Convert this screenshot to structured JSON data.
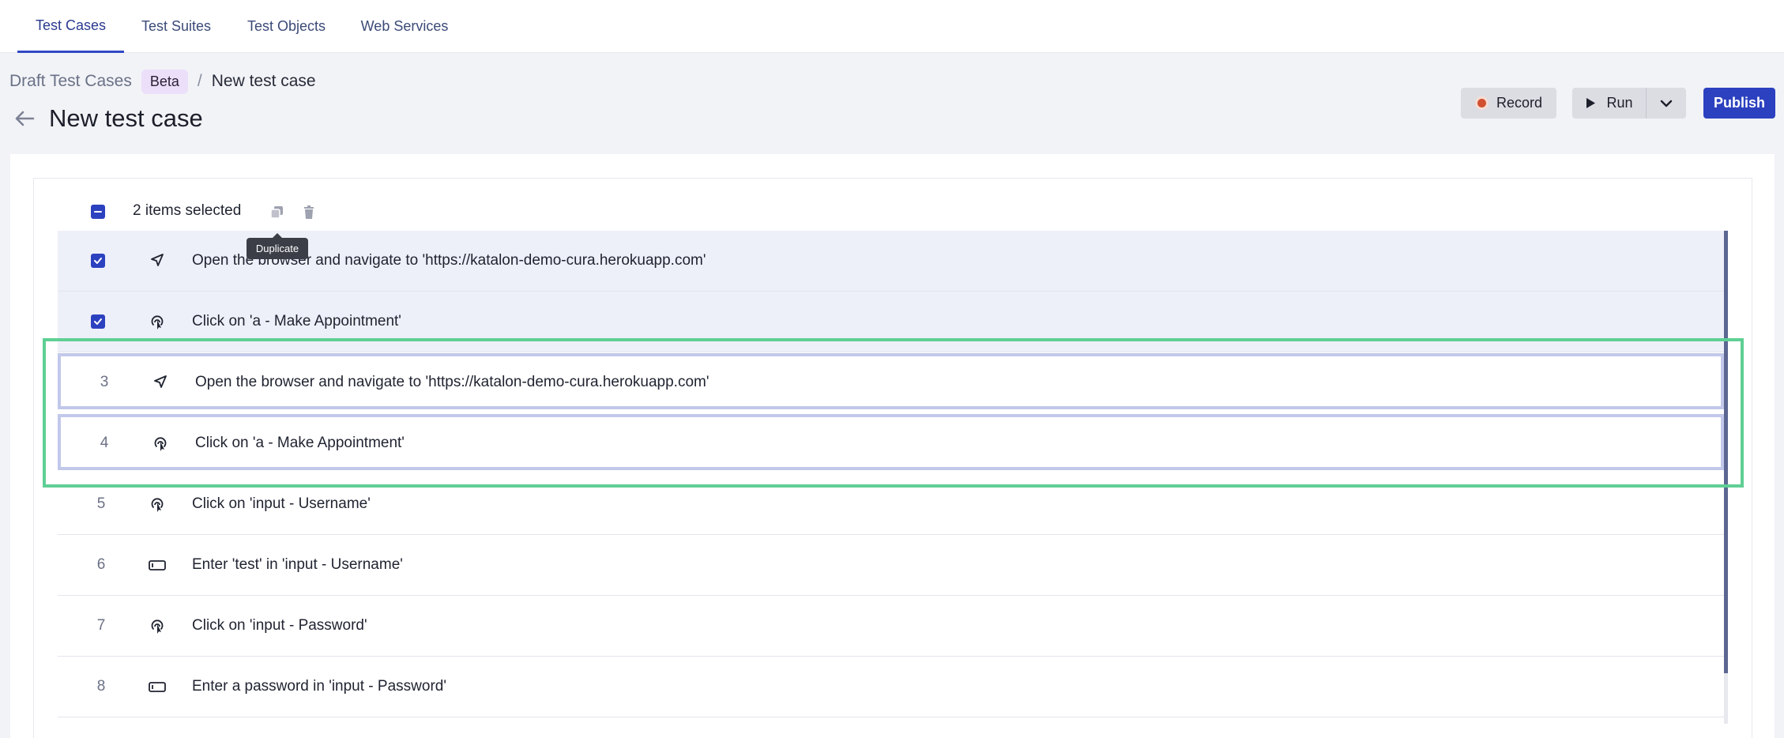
{
  "nav": {
    "tabs": [
      {
        "label": "Test Cases",
        "active": true
      },
      {
        "label": "Test Suites",
        "active": false
      },
      {
        "label": "Test Objects",
        "active": false
      },
      {
        "label": "Web Services",
        "active": false
      }
    ]
  },
  "breadcrumb": {
    "parent": "Draft Test Cases",
    "badge": "Beta",
    "separator": "/",
    "current": "New test case"
  },
  "page": {
    "title": "New test case"
  },
  "toolbar": {
    "record_label": "Record",
    "run_label": "Run",
    "publish_label": "Publish"
  },
  "selection": {
    "text": "2 items selected",
    "tooltip": "Duplicate"
  },
  "steps": [
    {
      "num": "",
      "selected": true,
      "icon": "navigate-icon",
      "text": "Open the browser and navigate to 'https://katalon-demo-cura.herokuapp.com'"
    },
    {
      "num": "",
      "selected": true,
      "icon": "click-icon",
      "text": "Click on 'a - Make Appointment'"
    },
    {
      "num": "3",
      "selected": false,
      "icon": "navigate-icon",
      "text": "Open the browser and navigate to 'https://katalon-demo-cura.herokuapp.com'"
    },
    {
      "num": "4",
      "selected": false,
      "icon": "click-icon",
      "text": "Click on 'a - Make Appointment'"
    },
    {
      "num": "5",
      "selected": false,
      "icon": "click-icon",
      "text": "Click on 'input - Username'"
    },
    {
      "num": "6",
      "selected": false,
      "icon": "input-icon",
      "text": "Enter 'test' in 'input - Username'"
    },
    {
      "num": "7",
      "selected": false,
      "icon": "click-icon",
      "text": "Click on 'input - Password'"
    },
    {
      "num": "8",
      "selected": false,
      "icon": "input-icon",
      "text": "Enter a password in 'input - Password'"
    }
  ],
  "colors": {
    "accent": "#2c41bf",
    "highlight": "#5fcf94",
    "record": "#d0502f"
  }
}
